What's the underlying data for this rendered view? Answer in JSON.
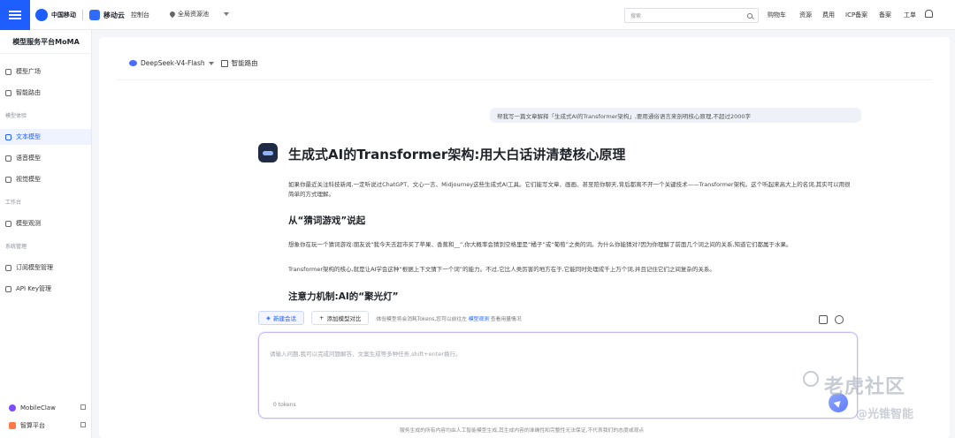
{
  "topbar": {
    "logo_text_1": "中国移动",
    "logo_text_2": "移动云",
    "console": "控制台",
    "region": "全局资源池",
    "search_placeholder": "搜索",
    "right_links": [
      "购物车",
      "资源",
      "费用",
      "ICP备案",
      "备案",
      "工单"
    ]
  },
  "sidebar": {
    "title": "模型服务平台MoMA",
    "items_top": [
      "模型广场",
      "智能路由"
    ],
    "group_experience": "模型体验",
    "items_experience": [
      "文本模型",
      "语音模型",
      "视觉模型"
    ],
    "group_workbench": "工作台",
    "items_workbench": [
      "模型观测"
    ],
    "group_system": "系统管理",
    "items_system": [
      "订阅模型管理",
      "API Key管理"
    ],
    "bottom_links": [
      "MobileClaw",
      "智算平台"
    ]
  },
  "main": {
    "model_name": "DeepSeek-V4-Flash",
    "route_label": "智能路由",
    "user_message": "帮我写一篇文章解释「生成式AI的Transformer架构」,要用通俗语言来剖明核心原理,不超过2000字",
    "answer_title": "生成式AI的Transformer架构:用大白话讲清楚核心原理",
    "intro": "如果你最近关注科技新闻,一定听说过ChatGPT、文心一言、Midjourney这些生成式AI工具。它们能写文章、画画、甚至陪你聊天,背后都离不开一个关键技术——Transformer架构。这个听起来高大上的名词,其实可以用很简单的方式理解。",
    "section1_title": "从“猜词游戏”说起",
    "section1_p1": "想象你在玩一个猜词游戏:朋友说“我今天去超市买了苹果、香蕉和__”,你大概率会猜到空格里是“橘子”或“葡萄”之类的词。为什么你能猜对?因为你理解了前面几个词之间的关系,知道它们都属于水果。",
    "section1_p2": "Transformer架构的核心,就是让AI学会这种“根据上下文猜下一个词”的能力。不过,它比人类厉害的地方在于,它能同时处理成千上万个词,并且记住它们之间复杂的关系。",
    "section2_title": "注意力机制:AI的“聚光灯”"
  },
  "input": {
    "new_chat": "新建会话",
    "add_compare": "添加模型对比",
    "tip": "体验模型将会消耗Tokens,您可以前往左",
    "tip_link": "模型观测",
    "tip_end": "查看用量情况",
    "placeholder": "请输入问题,我可以完成问题解答、文案生成等多种任务,shift+enter换行。",
    "tokens": "0 tokens",
    "disclaimer": "服务生成的所有内容均由人工智能模型生成,其生成内容的准确性和完整性无法保证,不代表我们的态度或观点"
  },
  "watermark": {
    "line1": "老虎社区",
    "line2": "@光锥智能"
  }
}
